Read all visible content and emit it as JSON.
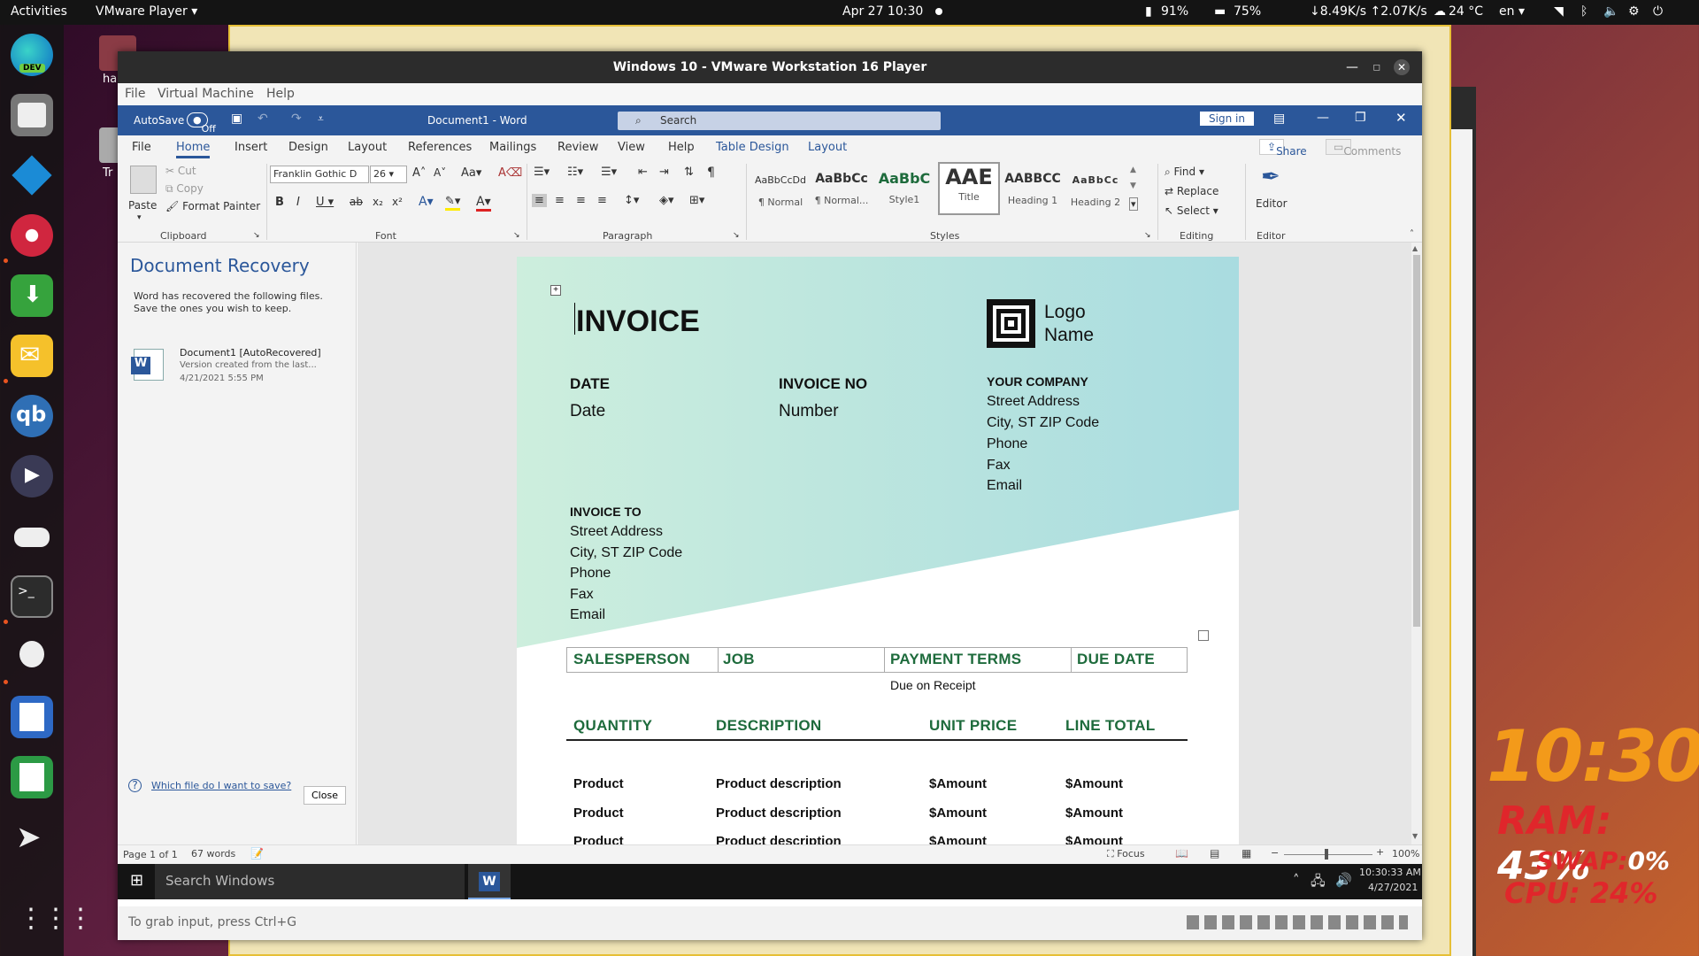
{
  "topbar": {
    "activities": "Activities",
    "app_menu": "VMware Player",
    "datetime": "Apr 27  10:30",
    "battery": "91%",
    "memory": "75%",
    "network": "↓8.49K/s ↑2.07K/s",
    "temperature": "24 °C",
    "language": "en"
  },
  "desktop": {
    "icon_label_1": "ha",
    "icon_label_2": "Tr"
  },
  "conky": {
    "time": "10:30",
    "ram_label": "RAM:",
    "ram_value": "43%",
    "swap_label": "SWAP:",
    "swap_value": "0%",
    "cpu_label": "CPU:",
    "cpu_value": "24%"
  },
  "vmware": {
    "title": "Windows 10 - VMware Workstation 16 Player",
    "menu": [
      "File",
      "Virtual Machine",
      "Help"
    ],
    "status_hint": "To grab input, press Ctrl+G"
  },
  "word": {
    "autosave_label": "AutoSave",
    "autosave_state": "Off",
    "doc_title": "Document1  -  Word",
    "search_placeholder": "Search",
    "sign_in": "Sign in",
    "tabs": [
      "File",
      "Home",
      "Insert",
      "Design",
      "Layout",
      "References",
      "Mailings",
      "Review",
      "View",
      "Help",
      "Table Design",
      "Layout"
    ],
    "share": "Share",
    "comments": "Comments",
    "clipboard": {
      "paste": "Paste",
      "cut": "Cut",
      "copy": "Copy",
      "format_painter": "Format Painter",
      "group": "Clipboard"
    },
    "font": {
      "name": "Franklin Gothic D",
      "size": "26",
      "group": "Font"
    },
    "paragraph": {
      "group": "Paragraph"
    },
    "styles": {
      "items": [
        {
          "preview": "AaBbCcDd",
          "name": "¶ Normal"
        },
        {
          "preview": "AaBbCc",
          "name": "¶ Normal..."
        },
        {
          "preview": "AaBbC",
          "name": "Style1"
        },
        {
          "preview": "AAE",
          "name": "Title"
        },
        {
          "preview": "AABBCC",
          "name": "Heading 1"
        },
        {
          "preview": "AaBbCc",
          "name": "Heading 2"
        }
      ],
      "group": "Styles"
    },
    "editing": {
      "find": "Find",
      "replace": "Replace",
      "select": "Select",
      "group": "Editing"
    },
    "editor": {
      "label": "Editor",
      "group": "Editor"
    },
    "recovery": {
      "title": "Document Recovery",
      "intro_line1": "Word has recovered the following files.",
      "intro_line2": "Save the ones you wish to keep.",
      "file_name": "Document1  [AutoRecovered]",
      "file_desc": "Version created from the last...",
      "file_date": "4/21/2021 5:55 PM",
      "help_link": "Which file do I want to save?",
      "close": "Close"
    },
    "status": {
      "page": "Page 1 of 1",
      "words": "67 words",
      "focus": "Focus",
      "zoom": "100%"
    }
  },
  "invoice": {
    "title": "INVOICE",
    "logo_line1": "Logo",
    "logo_line2": "Name",
    "date_label": "DATE",
    "date_value": "Date",
    "invno_label": "INVOICE NO",
    "invno_value": "Number",
    "company_label": "YOUR COMPANY",
    "company_lines": [
      "Street Address",
      "City, ST ZIP Code",
      "Phone",
      "Fax",
      "Email"
    ],
    "to_label": "INVOICE TO",
    "to_lines": [
      "Street Address",
      "City, ST ZIP Code",
      "Phone",
      "Fax",
      "Email"
    ],
    "table1_headers": [
      "SALESPERSON",
      "JOB",
      "PAYMENT TERMS",
      "DUE DATE"
    ],
    "payment_terms_value": "Due on Receipt",
    "table2_headers": [
      "QUANTITY",
      "DESCRIPTION",
      "UNIT PRICE",
      "LINE TOTAL"
    ],
    "rows": [
      {
        "qty": "Product",
        "desc": "Product description",
        "unit": "$Amount",
        "total": "$Amount"
      },
      {
        "qty": "Product",
        "desc": "Product description",
        "unit": "$Amount",
        "total": "$Amount"
      },
      {
        "qty": "Product",
        "desc": "Product description",
        "unit": "$Amount",
        "total": "$Amount"
      }
    ]
  },
  "taskbar": {
    "search": "Search Windows",
    "time": "10:30:33 AM",
    "date": "4/27/2021"
  },
  "colors": {
    "word_blue": "#2b579a",
    "invoice_green": "#1e6b3c",
    "teal_gradient_start": "#cdeedd",
    "teal_gradient_end": "#a9dce0",
    "ubuntu_orange": "#e95420"
  }
}
